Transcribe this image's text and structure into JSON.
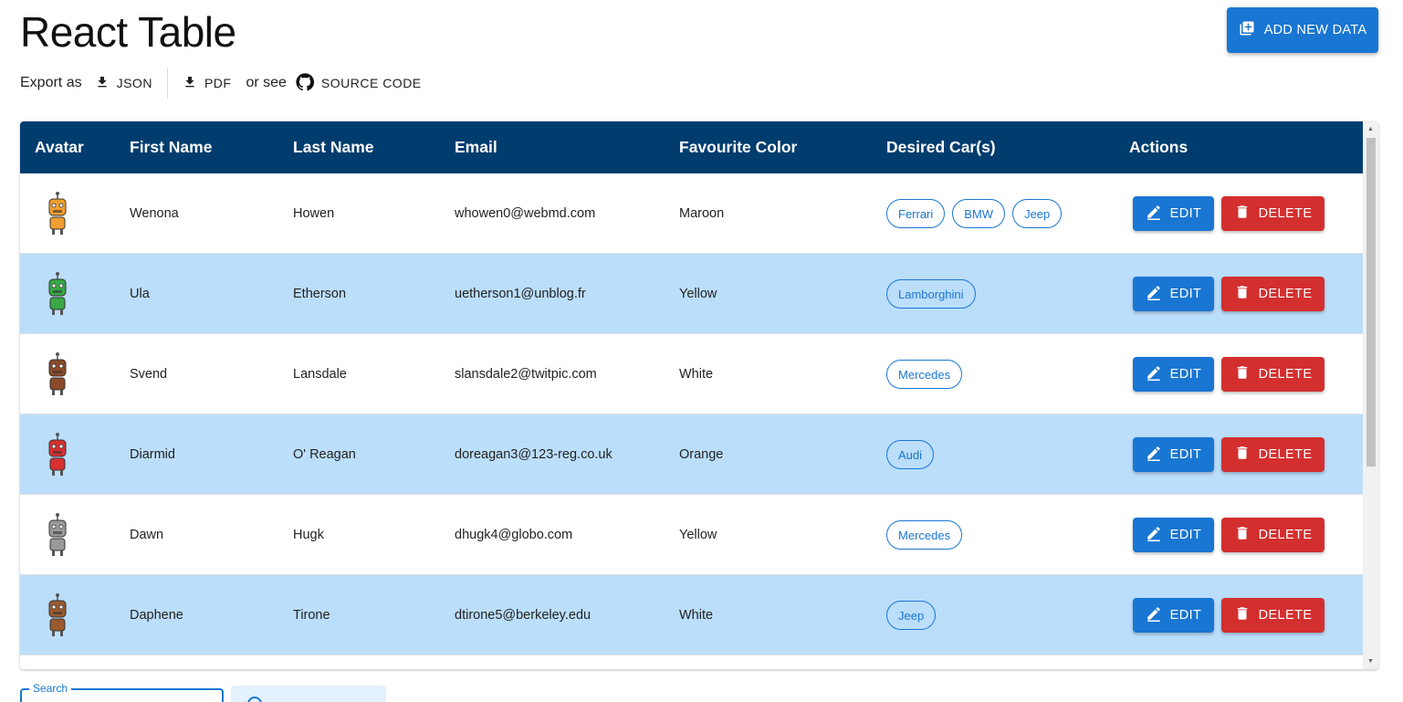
{
  "page": {
    "title": "React Table",
    "add_button_label": "ADD NEW DATA"
  },
  "export": {
    "label": "Export as",
    "json_label": "JSON",
    "pdf_label": "PDF",
    "or_see_label": "or see",
    "source_label": "SOURCE CODE"
  },
  "table": {
    "columns": [
      "Avatar",
      "First Name",
      "Last Name",
      "Email",
      "Favourite Color",
      "Desired Car(s)",
      "Actions"
    ],
    "edit_label": "EDIT",
    "delete_label": "DELETE",
    "rows": [
      {
        "first": "Wenona",
        "last": "Howen",
        "email": "whowen0@webmd.com",
        "color": "Maroon",
        "cars": [
          "Ferrari",
          "BMW",
          "Jeep"
        ],
        "avatar_color": "#f0a030"
      },
      {
        "first": "Ula",
        "last": "Etherson",
        "email": "uetherson1@unblog.fr",
        "color": "Yellow",
        "cars": [
          "Lamborghini"
        ],
        "avatar_color": "#3aa845"
      },
      {
        "first": "Svend",
        "last": "Lansdale",
        "email": "slansdale2@twitpic.com",
        "color": "White",
        "cars": [
          "Mercedes"
        ],
        "avatar_color": "#8a4a2a"
      },
      {
        "first": "Diarmid",
        "last": "O' Reagan",
        "email": "doreagan3@123-reg.co.uk",
        "color": "Orange",
        "cars": [
          "Audi"
        ],
        "avatar_color": "#d83030"
      },
      {
        "first": "Dawn",
        "last": "Hugk",
        "email": "dhugk4@globo.com",
        "color": "Yellow",
        "cars": [
          "Mercedes"
        ],
        "avatar_color": "#9a9a9a"
      },
      {
        "first": "Daphene",
        "last": "Tirone",
        "email": "dtirone5@berkeley.edu",
        "color": "White",
        "cars": [
          "Jeep"
        ],
        "avatar_color": "#9a5a30"
      }
    ]
  },
  "footer": {
    "search_label": "Search"
  },
  "colors": {
    "header_bg": "#003d6e",
    "primary": "#1976d2",
    "danger": "#d32f2f",
    "row_alt": "#bbdefb"
  }
}
